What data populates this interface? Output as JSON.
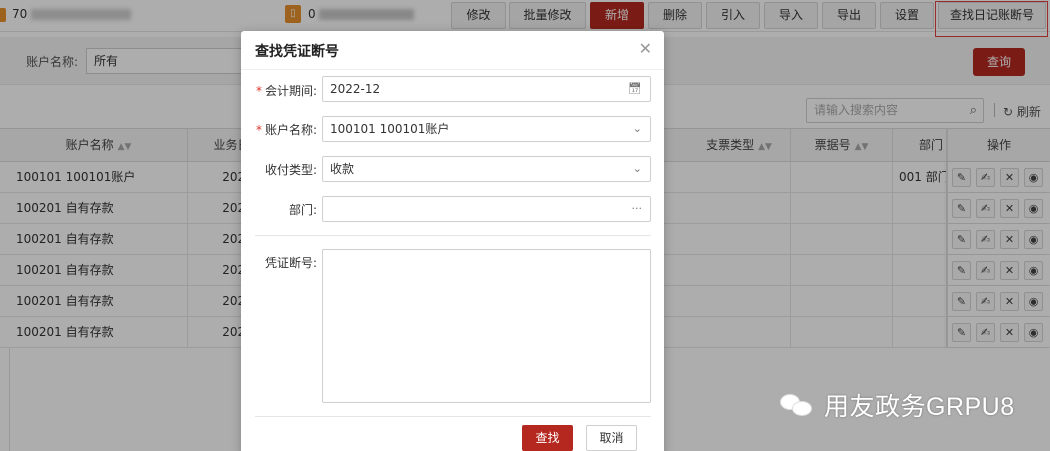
{
  "topbar": {
    "org_prefix": "70",
    "book_prefix": "0",
    "book_icon_glyph": "▯",
    "buttons": [
      {
        "label": "修改",
        "name": "edit-button"
      },
      {
        "label": "批量修改",
        "name": "batch-edit-button"
      },
      {
        "label": "新增",
        "name": "add-button",
        "primary": true
      },
      {
        "label": "删除",
        "name": "delete-button"
      },
      {
        "label": "引入",
        "name": "import-in-button"
      },
      {
        "label": "导入",
        "name": "import-button"
      },
      {
        "label": "导出",
        "name": "export-button"
      },
      {
        "label": "设置",
        "name": "settings-button"
      },
      {
        "label": "查找日记账断号",
        "name": "find-journal-gap-button"
      }
    ]
  },
  "filter": {
    "account_label": "账户名称:",
    "account_value": "所有",
    "query_label": "查询"
  },
  "search": {
    "placeholder": "请输入搜索内容",
    "refresh_label": "刷新"
  },
  "table": {
    "columns": [
      "账户名称",
      "业务日期",
      "支票类型",
      "票据号",
      "部门",
      "操作"
    ],
    "rows": [
      {
        "account": "100101 100101账户",
        "date": "2022",
        "dept": "001 部门"
      },
      {
        "account": "100201 自有存款",
        "date": "2022",
        "dept": ""
      },
      {
        "account": "100201 自有存款",
        "date": "2022",
        "dept": ""
      },
      {
        "account": "100201 自有存款",
        "date": "2022",
        "dept": ""
      },
      {
        "account": "100201 自有存款",
        "date": "2022",
        "dept": ""
      },
      {
        "account": "100201 自有存款",
        "date": "2022",
        "dept": ""
      }
    ]
  },
  "dialog": {
    "title": "查找凭证断号",
    "close_glyph": "✕",
    "period_label": "会计期间:",
    "period_value": "2022-12",
    "account_label": "账户名称:",
    "account_value": "100101 100101账户",
    "paytype_label": "收付类型:",
    "paytype_value": "收款",
    "dept_label": "部门:",
    "dept_value": "",
    "gap_label": "凭证断号:",
    "find_label": "查找",
    "cancel_label": "取消"
  },
  "watermark": {
    "text": "用友政务GRPU8"
  },
  "colors": {
    "primary": "#b5281f",
    "accent_orange": "#e8912c",
    "required": "#d9342b"
  }
}
